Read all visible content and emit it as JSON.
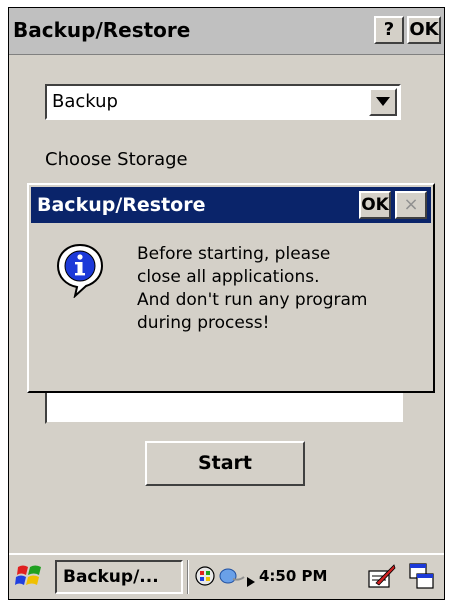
{
  "window": {
    "title": "Backup/Restore",
    "help_label": "?",
    "ok_label": "OK"
  },
  "form": {
    "mode_value": "Backup",
    "storage_label": "Choose Storage",
    "path_value": "",
    "start_label": "Start"
  },
  "dialog": {
    "title": "Backup/Restore",
    "ok_label": "OK",
    "close_glyph": "×",
    "icon": "info-icon",
    "message_lines": [
      "Before starting, please",
      "close all applications.",
      "And don't run any program",
      "during process!"
    ]
  },
  "taskbar": {
    "task_label": "Backup/...",
    "clock": "4:50 PM",
    "icons": [
      "start-flag-icon",
      "network-icon",
      "connection-icon",
      "input-panel-icon",
      "switch-window-icon"
    ]
  },
  "colors": {
    "dialog_titlebar": "#0a246a",
    "face": "#d4d0c8"
  }
}
